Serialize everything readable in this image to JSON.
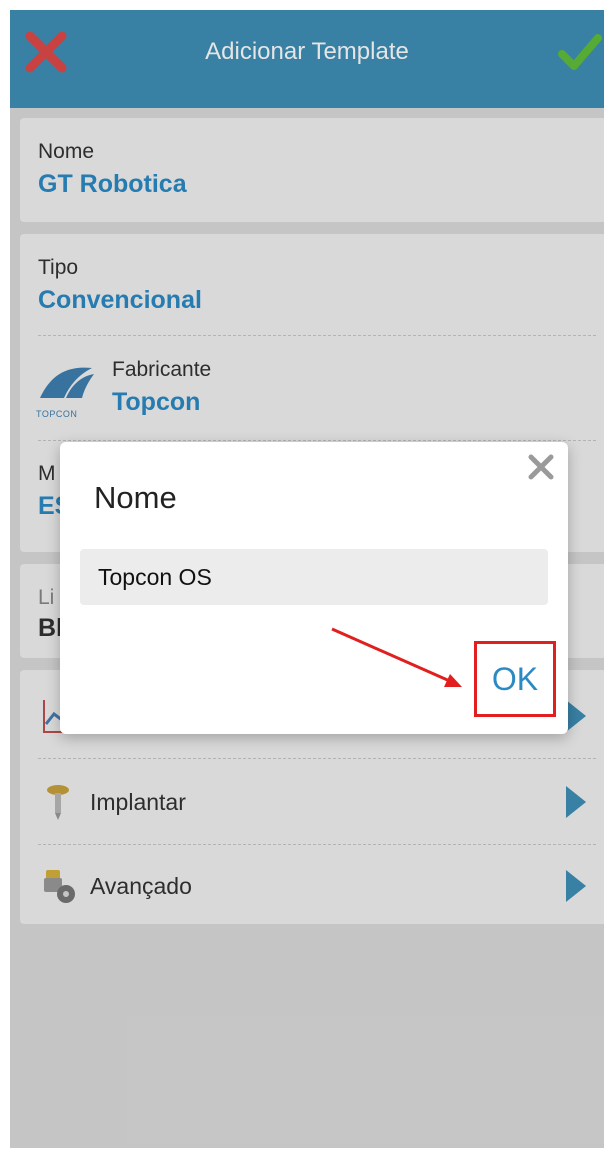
{
  "header": {
    "title": "Adicionar Template",
    "cancel_icon": "close-x-icon",
    "confirm_icon": "checkmark-icon",
    "bar_color": "#3f8fb7"
  },
  "form": {
    "name_label": "Nome",
    "name_value": "GT Robotica",
    "type_label": "Tipo",
    "type_value": "Convencional",
    "manufacturer_label": "Fabricante",
    "manufacturer_value": "Topcon",
    "manufacturer_logo_text": "TOPCON",
    "model_label": "M",
    "model_value": "ES",
    "line_label": "Li",
    "line_value": "Bl"
  },
  "nav": {
    "items": [
      {
        "label": "",
        "icon": "chart-icon"
      },
      {
        "label": "Implantar",
        "icon": "stake-pin-icon"
      },
      {
        "label": "Avançado",
        "icon": "gears-icon"
      }
    ]
  },
  "dialog": {
    "title": "Nome",
    "input_value": "Topcon OS",
    "ok_label": "OK",
    "close_icon": "close-x-icon"
  },
  "colors": {
    "accent": "#2b8ac4",
    "highlight": "#e11f1f"
  }
}
